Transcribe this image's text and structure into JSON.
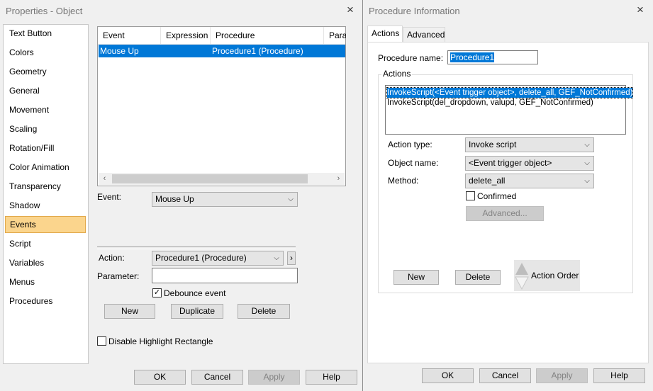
{
  "left": {
    "title": "Properties - Object",
    "nav": [
      "Text Button",
      "Colors",
      "Geometry",
      "General",
      "Movement",
      "Scaling",
      "Rotation/Fill",
      "Color Animation",
      "Transparency",
      "Shadow",
      "Events",
      "Script",
      "Variables",
      "Menus",
      "Procedures"
    ],
    "selected_nav": "Events",
    "list": {
      "columns": [
        "Event",
        "Expression",
        "Procedure",
        "Parai"
      ],
      "rows": [
        {
          "event": "Mouse Up",
          "expression": "",
          "procedure": "Procedure1 (Procedure)"
        }
      ]
    },
    "event_label": "Event:",
    "event_value": "Mouse Up",
    "action_label": "Action:",
    "action_value": "Procedure1 (Procedure)",
    "parameter_label": "Parameter:",
    "parameter_value": "",
    "debounce_label": "Debounce event",
    "debounce_checked": true,
    "new_label": "New",
    "duplicate_label": "Duplicate",
    "delete_label": "Delete",
    "highlight_label": "Disable Highlight Rectangle",
    "highlight_checked": false,
    "ok": "OK",
    "cancel": "Cancel",
    "apply": "Apply",
    "help": "Help"
  },
  "right": {
    "title": "Procedure Information",
    "tabs": [
      "Actions",
      "Advanced"
    ],
    "active_tab": "Actions",
    "procedure_name_label": "Procedure name:",
    "procedure_name_value": "Procedure1",
    "actions_group_label": "Actions",
    "actions": [
      "InvokeScript(<Event trigger object>, delete_all, GEF_NotConfirmed)",
      "InvokeScript(del_dropdown, valupd, GEF_NotConfirmed)"
    ],
    "action_type_label": "Action type:",
    "action_type_value": "Invoke script",
    "object_name_label": "Object name:",
    "object_name_value": "<Event trigger object>",
    "method_label": "Method:",
    "method_value": "delete_all",
    "confirmed_label": "Confirmed",
    "confirmed_checked": false,
    "advanced_button": "Advanced...",
    "new_label": "New",
    "delete_label": "Delete",
    "action_order_label": "Action Order",
    "ok": "OK",
    "cancel": "Cancel",
    "apply": "Apply",
    "help": "Help"
  },
  "icons": {
    "close": "×",
    "chevron_down": "⌵",
    "arrow_left": "‹",
    "arrow_right": "›",
    "check": "✓",
    "expand_right": "›"
  },
  "colors": {
    "selection": "#0078d7",
    "nav_selected": "#fbd58d"
  }
}
